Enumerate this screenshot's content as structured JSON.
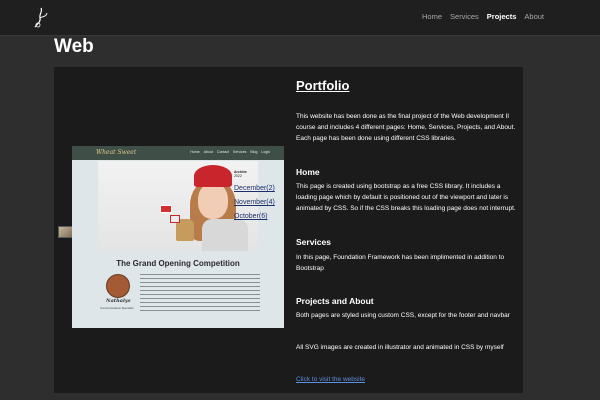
{
  "nav": {
    "links": [
      {
        "label": "Home"
      },
      {
        "label": "Services"
      },
      {
        "label": "Projects"
      },
      {
        "label": "About"
      }
    ],
    "active": "Projects"
  },
  "page": {
    "title": "Web"
  },
  "portfolio": {
    "title": "Portfolio",
    "intro": "This website has been done as the final project of the Web development II course and includes 4 different pages: Home, Services, Projects, and About. Each page has been done using different CSS libraries.",
    "sections": [
      {
        "title": "Home",
        "text": "This page is created using bootstrap as a free CSS library. It includes a loading page which by default is positioned out of the viewport and later is animated by CSS. So if the CSS breaks this loading page does not interrupt."
      },
      {
        "title": "Services",
        "text": "In this page, Foundation Framework has been implimented in addition to Bootstrap"
      },
      {
        "title": "Projects and About",
        "text": "Both pages are styled using custom CSS, except for the footer and navbar"
      }
    ],
    "svg_note": "All SVG images are created in illustrator and animated in CSS by myself",
    "link_label": "Click to visit the website"
  },
  "preview": {
    "logo": "Wheat Sweet",
    "nav_links": [
      "Home",
      "About",
      "Contact",
      "Services",
      "Blog",
      "Login"
    ],
    "archive_title": "Archive",
    "archive_year": "2022",
    "archive_links": [
      "December(2)",
      "November(4)",
      "October(6)"
    ],
    "heading": "The Grand Opening Competition",
    "author_name": "Nathalys",
    "author_role": "Communications Specialist"
  }
}
